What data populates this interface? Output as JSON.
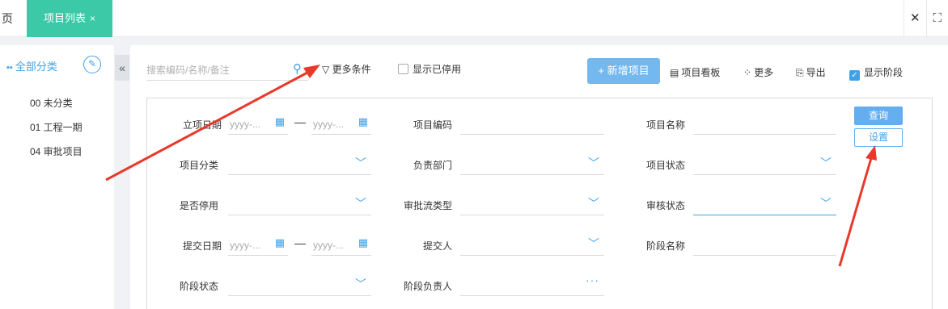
{
  "tabs": {
    "home": "页",
    "active": "项目列表",
    "close": "×"
  },
  "tab_tools": {
    "close": "✕",
    "fullscreen": "⛶"
  },
  "left": {
    "title": "全部分类",
    "items": [
      {
        "label": "00 未分类"
      },
      {
        "label": "01 工程一期"
      },
      {
        "label": "04 审批项目"
      }
    ]
  },
  "toolbar": {
    "search_placeholder": "搜索编码/名称/备注",
    "more_filters": "更多条件",
    "show_disabled": "显示已停用",
    "add_project": "+ 新增项目",
    "kanban": "项目看板",
    "more": "更多",
    "export": "导出",
    "show_stage": "显示阶段"
  },
  "filters": {
    "start_date": "立项日期",
    "code": "项目编码",
    "name": "项目名称",
    "category": "项目分类",
    "dept": "负责部门",
    "status": "项目状态",
    "disabled": "是否停用",
    "flow_type": "审批流类型",
    "review_status": "审核状态",
    "submit_date": "提交日期",
    "submitter": "提交人",
    "stage_name": "阶段名称",
    "stage_status": "阶段状态",
    "stage_owner": "阶段负责人",
    "date_placeholder": "yyyy-...",
    "range_sep": "—",
    "query": "查询",
    "settings": "设置"
  },
  "colors": {
    "accent": "#3fa2e8",
    "tab": "#3cc9a8",
    "annotation": "#e8392b"
  }
}
